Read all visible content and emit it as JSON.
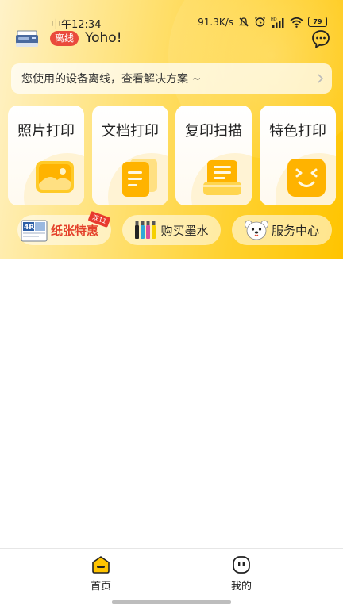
{
  "status": {
    "time": "中午12:34",
    "net_speed": "91.3K/s",
    "battery": "79",
    "icons": [
      "mute-icon",
      "alarm-icon",
      "hd-signal-icon",
      "wifi-icon",
      "battery-icon"
    ]
  },
  "header": {
    "badge": "离线",
    "greeting": "Yoho!",
    "icons": [
      "printer-icon",
      "chat-icon"
    ]
  },
  "notice": {
    "text": "您使用的设备离线，查看解决方案 ~",
    "icon": "chevron-right-icon"
  },
  "features": [
    {
      "label": "照片打印",
      "icon": "photo-icon"
    },
    {
      "label": "文档打印",
      "icon": "document-icon"
    },
    {
      "label": "复印扫描",
      "icon": "scan-icon"
    },
    {
      "label": "特色打印",
      "icon": "smiley-icon"
    }
  ],
  "quick_actions": [
    {
      "label": "纸张特惠",
      "icon": "paper-pack-icon",
      "tag": "双11"
    },
    {
      "label": "购买墨水",
      "icon": "ink-bottles-icon"
    },
    {
      "label": "服务中心",
      "icon": "mascot-icon"
    }
  ],
  "nav": {
    "items": [
      {
        "label": "首页",
        "icon": "home-icon",
        "active": true
      },
      {
        "label": "我的",
        "icon": "profile-icon",
        "active": false
      }
    ]
  },
  "colors": {
    "accent": "#ffc400",
    "badge": "#ea4a3c",
    "promo": "#e4412b"
  }
}
